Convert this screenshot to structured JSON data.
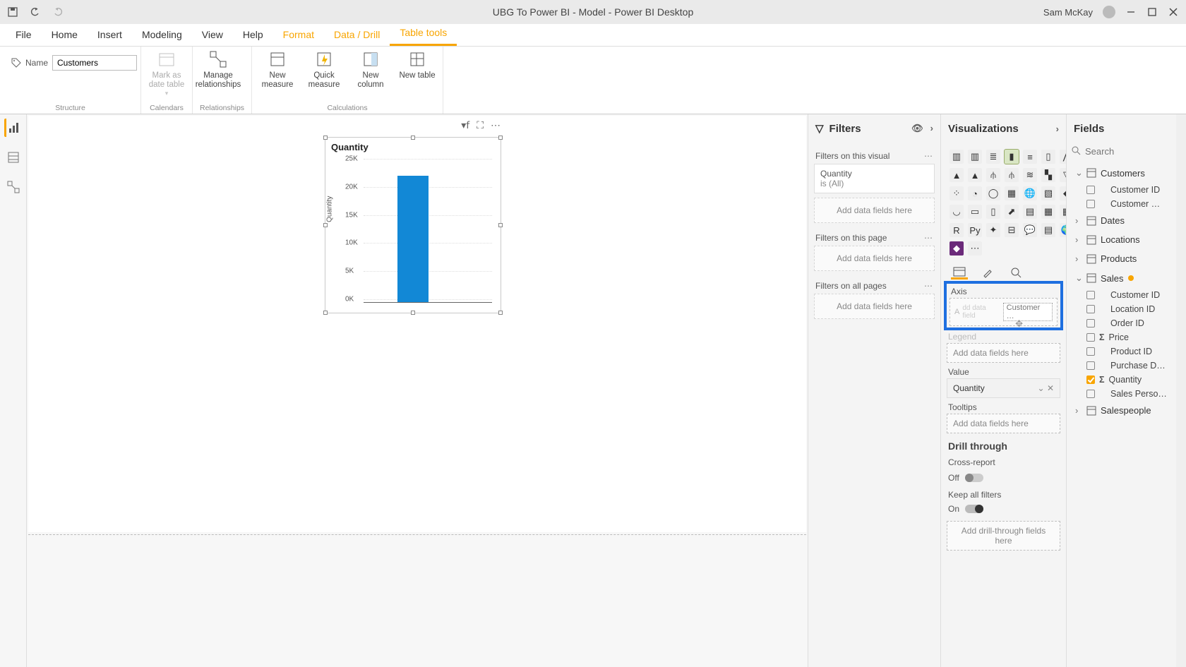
{
  "titlebar": {
    "title": "UBG To Power BI - Model - Power BI Desktop",
    "user": "Sam McKay"
  },
  "ribbon_tabs": [
    "File",
    "Home",
    "Insert",
    "Modeling",
    "View",
    "Help",
    "Format",
    "Data / Drill",
    "Table tools"
  ],
  "ribbon_active_tab": "Table tools",
  "ribbon": {
    "name_label": "Name",
    "name_value": "Customers",
    "structure_group": "Structure",
    "calendars_group": "Calendars",
    "relationships_group": "Relationships",
    "calculations_group": "Calculations",
    "mark_as_date": "Mark as date table",
    "manage_rel": "Manage relationships",
    "new_measure": "New measure",
    "quick_measure": "Quick measure",
    "new_column": "New column",
    "new_table": "New table"
  },
  "visual": {
    "title": "Quantity",
    "ylabel": "Quantity"
  },
  "chart_data": {
    "type": "bar",
    "title": "Quantity",
    "ylabel": "Quantity",
    "xlabel": "",
    "ylim": [
      0,
      25000
    ],
    "yticks_labels": [
      "0K",
      "5K",
      "10K",
      "15K",
      "20K",
      "25K"
    ],
    "yticks_values": [
      0,
      5000,
      10000,
      15000,
      20000,
      25000
    ],
    "categories": [
      ""
    ],
    "values": [
      22500
    ]
  },
  "filters": {
    "header": "Filters",
    "on_visual": "Filters on this visual",
    "quantity_name": "Quantity",
    "quantity_state": "is (All)",
    "add_here": "Add data fields here",
    "on_page": "Filters on this page",
    "on_all": "Filters on all pages"
  },
  "viz": {
    "header": "Visualizations",
    "axis": "Axis",
    "axis_drag_hint": "Add data field",
    "axis_drag_ghost": "Customer …",
    "legend": "Legend",
    "value": "Value",
    "value_field": "Quantity",
    "tooltips": "Tooltips",
    "add_here": "Add data fields here",
    "drill": "Drill through",
    "cross": "Cross-report",
    "cross_state": "Off",
    "keep": "Keep all filters",
    "keep_state": "On",
    "drill_add": "Add drill-through fields here"
  },
  "fields": {
    "header": "Fields",
    "search_ph": "Search",
    "tables": [
      {
        "name": "Customers",
        "expanded": true,
        "fields": [
          {
            "name": "Customer ID"
          },
          {
            "name": "Customer …"
          }
        ]
      },
      {
        "name": "Dates",
        "expanded": false
      },
      {
        "name": "Locations",
        "expanded": false
      },
      {
        "name": "Products",
        "expanded": false
      },
      {
        "name": "Sales",
        "expanded": true,
        "hot": true,
        "fields": [
          {
            "name": "Customer ID"
          },
          {
            "name": "Location ID"
          },
          {
            "name": "Order ID"
          },
          {
            "name": "Price",
            "sigma": true
          },
          {
            "name": "Product ID"
          },
          {
            "name": "Purchase D…"
          },
          {
            "name": "Quantity",
            "sigma": true,
            "checked": true
          },
          {
            "name": "Sales Perso…"
          }
        ]
      },
      {
        "name": "Salespeople",
        "expanded": false
      }
    ]
  }
}
